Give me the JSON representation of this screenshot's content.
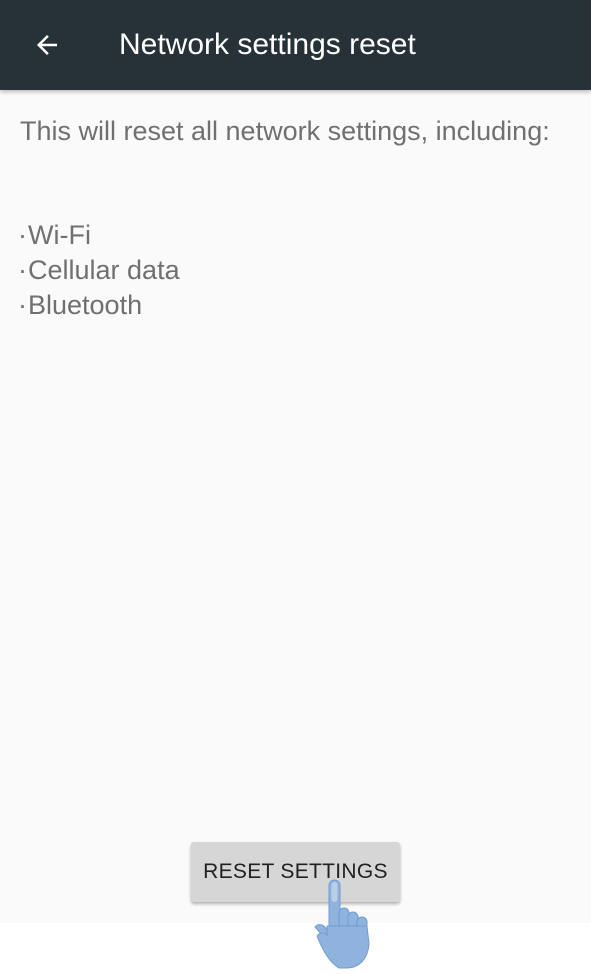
{
  "header": {
    "title": "Network settings reset",
    "back_icon": "arrow-left-icon",
    "background_color": "#263238"
  },
  "content": {
    "description": "This will reset all network settings, including:",
    "items": [
      "Wi-Fi",
      "Cellular data",
      "Bluetooth"
    ]
  },
  "actions": {
    "reset_label": "RESET SETTINGS"
  },
  "overlay": {
    "pointer_icon": "tap-hand-icon"
  }
}
